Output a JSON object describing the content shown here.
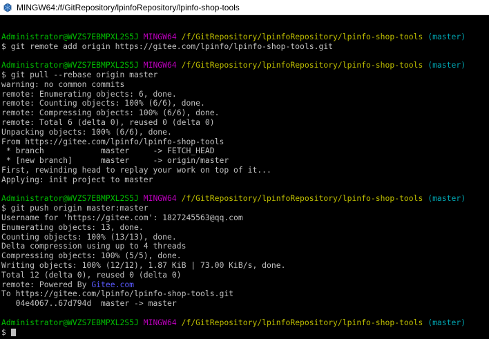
{
  "window": {
    "title": "MINGW64:/f/GitRepository/lpinfoRepository/lpinfo-shop-tools"
  },
  "colors": {
    "user": "#00bf00",
    "shell": "#bf00bf",
    "path": "#bfbf00",
    "branch": "#00a6b2",
    "link": "#5a5aff",
    "text": "#c0c0c0"
  },
  "terminal": {
    "lines": [
      {
        "segments": []
      },
      {
        "segments": [
          {
            "text": "Administrator@WVZS7EBMPXL2S5J",
            "color": "green"
          },
          {
            "text": " ",
            "color": "default"
          },
          {
            "text": "MINGW64",
            "color": "magenta"
          },
          {
            "text": " ",
            "color": "default"
          },
          {
            "text": "/f/GitRepository/lpinfoRepository/lpinfo-shop-tools",
            "color": "yellow"
          },
          {
            "text": " ",
            "color": "default"
          },
          {
            "text": "(master)",
            "color": "cyan"
          }
        ]
      },
      {
        "segments": [
          {
            "text": "$ git remote add origin https://gitee.com/lpinfo/lpinfo-shop-tools.git",
            "color": "default"
          }
        ]
      },
      {
        "segments": []
      },
      {
        "segments": [
          {
            "text": "Administrator@WVZS7EBMPXL2S5J",
            "color": "green"
          },
          {
            "text": " ",
            "color": "default"
          },
          {
            "text": "MINGW64",
            "color": "magenta"
          },
          {
            "text": " ",
            "color": "default"
          },
          {
            "text": "/f/GitRepository/lpinfoRepository/lpinfo-shop-tools",
            "color": "yellow"
          },
          {
            "text": " ",
            "color": "default"
          },
          {
            "text": "(master)",
            "color": "cyan"
          }
        ]
      },
      {
        "segments": [
          {
            "text": "$ git pull --rebase origin master",
            "color": "default"
          }
        ]
      },
      {
        "segments": [
          {
            "text": "warning: no common commits",
            "color": "default"
          }
        ]
      },
      {
        "segments": [
          {
            "text": "remote: Enumerating objects: 6, done.",
            "color": "default"
          }
        ]
      },
      {
        "segments": [
          {
            "text": "remote: Counting objects: 100% (6/6), done.",
            "color": "default"
          }
        ]
      },
      {
        "segments": [
          {
            "text": "remote: Compressing objects: 100% (6/6), done.",
            "color": "default"
          }
        ]
      },
      {
        "segments": [
          {
            "text": "remote: Total 6 (delta 0), reused 0 (delta 0)",
            "color": "default"
          }
        ]
      },
      {
        "segments": [
          {
            "text": "Unpacking objects: 100% (6/6), done.",
            "color": "default"
          }
        ]
      },
      {
        "segments": [
          {
            "text": "From https://gitee.com/lpinfo/lpinfo-shop-tools",
            "color": "default"
          }
        ]
      },
      {
        "segments": [
          {
            "text": " * branch            master     -> FETCH_HEAD",
            "color": "default"
          }
        ]
      },
      {
        "segments": [
          {
            "text": " * [new branch]      master     -> origin/master",
            "color": "default"
          }
        ]
      },
      {
        "segments": [
          {
            "text": "First, rewinding head to replay your work on top of it...",
            "color": "default"
          }
        ]
      },
      {
        "segments": [
          {
            "text": "Applying: init project to master",
            "color": "default"
          }
        ]
      },
      {
        "segments": []
      },
      {
        "segments": [
          {
            "text": "Administrator@WVZS7EBMPXL2S5J",
            "color": "green"
          },
          {
            "text": " ",
            "color": "default"
          },
          {
            "text": "MINGW64",
            "color": "magenta"
          },
          {
            "text": " ",
            "color": "default"
          },
          {
            "text": "/f/GitRepository/lpinfoRepository/lpinfo-shop-tools",
            "color": "yellow"
          },
          {
            "text": " ",
            "color": "default"
          },
          {
            "text": "(master)",
            "color": "cyan"
          }
        ]
      },
      {
        "segments": [
          {
            "text": "$ git push origin master:master",
            "color": "default"
          }
        ]
      },
      {
        "segments": [
          {
            "text": "Username for 'https://gitee.com': 1827245563@qq.com",
            "color": "default"
          }
        ]
      },
      {
        "segments": [
          {
            "text": "Enumerating objects: 13, done.",
            "color": "default"
          }
        ]
      },
      {
        "segments": [
          {
            "text": "Counting objects: 100% (13/13), done.",
            "color": "default"
          }
        ]
      },
      {
        "segments": [
          {
            "text": "Delta compression using up to 4 threads",
            "color": "default"
          }
        ]
      },
      {
        "segments": [
          {
            "text": "Compressing objects: 100% (5/5), done.",
            "color": "default"
          }
        ]
      },
      {
        "segments": [
          {
            "text": "Writing objects: 100% (12/12), 1.87 KiB | 73.00 KiB/s, done.",
            "color": "default"
          }
        ]
      },
      {
        "segments": [
          {
            "text": "Total 12 (delta 0), reused 0 (delta 0)",
            "color": "default"
          }
        ]
      },
      {
        "segments": [
          {
            "text": "remote: Powered By ",
            "color": "default"
          },
          {
            "text": "Gitee.com",
            "color": "blue"
          }
        ]
      },
      {
        "segments": [
          {
            "text": "To https://gitee.com/lpinfo/lpinfo-shop-tools.git",
            "color": "default"
          }
        ]
      },
      {
        "segments": [
          {
            "text": "   04e4067..67d794d  master -> master",
            "color": "default"
          }
        ]
      },
      {
        "segments": []
      },
      {
        "segments": [
          {
            "text": "Administrator@WVZS7EBMPXL2S5J",
            "color": "green"
          },
          {
            "text": " ",
            "color": "default"
          },
          {
            "text": "MINGW64",
            "color": "magenta"
          },
          {
            "text": " ",
            "color": "default"
          },
          {
            "text": "/f/GitRepository/lpinfoRepository/lpinfo-shop-tools",
            "color": "yellow"
          },
          {
            "text": " ",
            "color": "default"
          },
          {
            "text": "(master)",
            "color": "cyan"
          }
        ]
      },
      {
        "segments": [
          {
            "text": "$ ",
            "color": "default"
          }
        ]
      }
    ]
  }
}
